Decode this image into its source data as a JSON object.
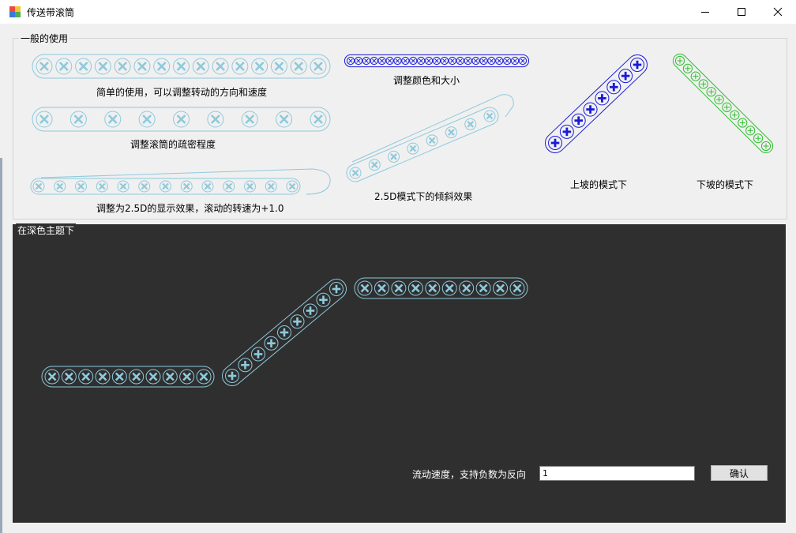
{
  "window": {
    "title": "传送带滚筒",
    "minimize_icon": "minimize-icon",
    "maximize_icon": "maximize-icon",
    "close_icon": "close-icon"
  },
  "group_general": {
    "title": "一般的使用",
    "caption_simple": "简单的使用，可以调整转动的方向和速度",
    "caption_color_size": "调整颜色和大小",
    "caption_density": "调整滚筒的疏密程度",
    "caption_25d": "调整为2.5D的显示效果，滚动的转速为+1.0",
    "caption_tilt": "2.5D模式下的倾斜效果",
    "caption_uphill": "上坡的模式下",
    "caption_downhill": "下坡的模式下"
  },
  "group_dark": {
    "title": "在深色主题下",
    "speed_label": "流动速度，支持负数为反向",
    "speed_value": "1",
    "confirm_label": "确认"
  },
  "colors": {
    "light_blue": "#8ec9dc",
    "blue": "#1a1ad8",
    "green": "#2fbf2f",
    "dark_bg": "#2f2f2f"
  }
}
